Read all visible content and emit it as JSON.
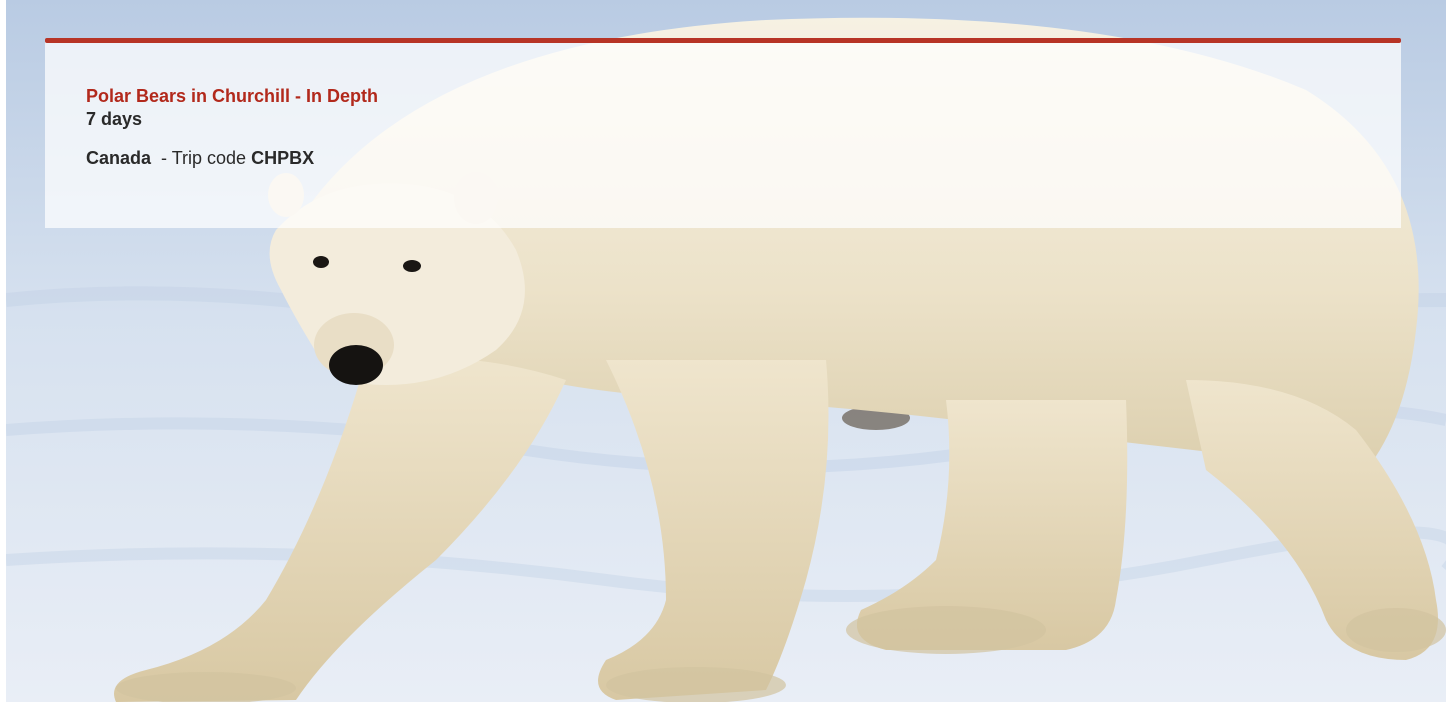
{
  "trip": {
    "title": "Polar Bears in Churchill - In Depth",
    "duration": "7 days",
    "country": "Canada",
    "code_prefix": "- Trip code",
    "code": "CHPBX"
  },
  "colors": {
    "accent": "#b73426",
    "title": "#b2291c",
    "text": "#2a2a2a",
    "snow": "#dde7f3",
    "fur": "#efe7d4"
  },
  "image": {
    "subject": "polar-bear-on-snow"
  }
}
